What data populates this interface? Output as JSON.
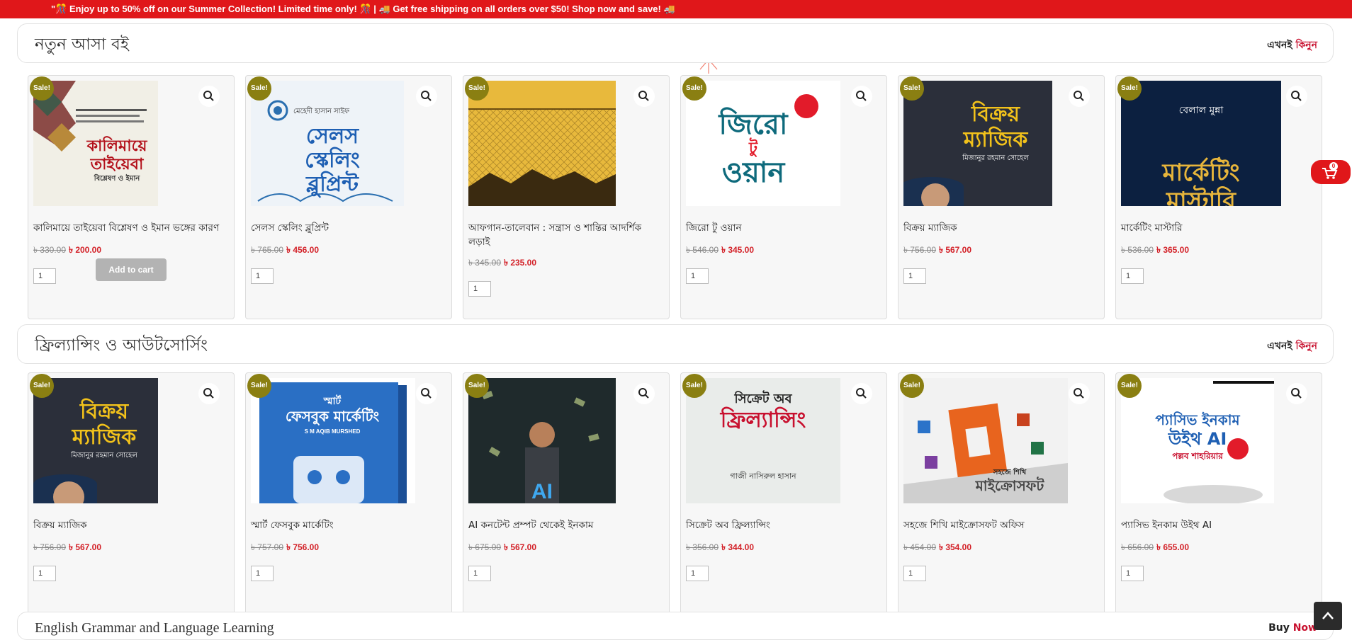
{
  "promo_bar": {
    "text": "\"🎊 Enjoy up to 50% off on our Summer Collection! Limited time only! 🎊 | 🚚 Get free shipping on all orders over $50! Shop now and save! 🚚"
  },
  "sections": [
    {
      "title": "নতুন আসা বই",
      "buy_now_word1": "এখনই",
      "buy_now_word2": "কিনুন",
      "products": [
        {
          "title": "কালিমায়ে তাইয়েবা বিশ্লেষণ ও ইমান ভঙ্গের কারণ",
          "old_price": "৳ 330.00",
          "price": "৳ 200.00",
          "qty": "1",
          "sale": "Sale!",
          "add_to_cart": "Add to cart",
          "cover_text": [
            "কালিমায়ে",
            "তাইয়েবা",
            "বিশ্লেষণ ও ইমান"
          ]
        },
        {
          "title": "সেলস স্কেলিং ব্লুপ্রিন্ট",
          "old_price": "৳ 765.00",
          "price": "৳ 456.00",
          "qty": "1",
          "sale": "Sale!",
          "cover_text": [
            "মেহেদী হাসান সাইফ",
            "সেলস",
            "স্কেলিং",
            "ব্লুপ্রিন্ট"
          ]
        },
        {
          "title": "আফগান-তালেবান : সন্ত্রাস ও শান্তির আদর্শিক লড়াই",
          "old_price": "৳ 345.00",
          "price": "৳ 235.00",
          "qty": "1",
          "sale": "Sale!"
        },
        {
          "title": "জিরো টু ওয়ান",
          "old_price": "৳ 546.00",
          "price": "৳ 345.00",
          "qty": "1",
          "sale": "Sale!",
          "cover_text": [
            "জিরো",
            "টু",
            "ওয়ান"
          ]
        },
        {
          "title": "বিক্রয় ম্যাজিক",
          "old_price": "৳ 756.00",
          "price": "৳ 567.00",
          "qty": "1",
          "sale": "Sale!",
          "cover_text": [
            "বিক্রয়",
            "ম্যাজিক",
            "মিজানুর রহমান সোহেল"
          ]
        },
        {
          "title": "মার্কেটিং মাস্টারি",
          "old_price": "৳ 536.00",
          "price": "৳ 365.00",
          "qty": "1",
          "sale": "Sale!",
          "cover_text": [
            "বেলাল মুন্না",
            "মার্কেটিং",
            "মাস্টারি"
          ]
        }
      ]
    },
    {
      "title": "ফ্রিল্যান্সিং ও আউটসোর্সিং",
      "buy_now_word1": "এখনই",
      "buy_now_word2": "কিনুন",
      "products": [
        {
          "title": "বিক্রয় ম্যাজিক",
          "old_price": "৳ 756.00",
          "price": "৳ 567.00",
          "qty": "1",
          "sale": "Sale!",
          "cover_text": [
            "বিক্রয়",
            "ম্যাজিক",
            "মিজানুর রহমান সোহেল"
          ]
        },
        {
          "title": "স্মার্ট ফেসবুক মার্কেটিং",
          "old_price": "৳ 757.00",
          "price": "৳ 756.00",
          "qty": "1",
          "sale": "Sale!",
          "cover_text": [
            "স্মার্ট",
            "ফেসবুক মার্কেটিং",
            "S M AQIB MURSHED"
          ]
        },
        {
          "title": "AI কনটেন্ট প্রম্পট থেকেই ইনকাম",
          "old_price": "৳ 675.00",
          "price": "৳ 567.00",
          "qty": "1",
          "sale": "Sale!",
          "cover_text": [
            "AI"
          ]
        },
        {
          "title": "সিক্রেট অব ফ্রিল্যান্সিং",
          "old_price": "৳ 356.00",
          "price": "৳ 344.00",
          "qty": "1",
          "sale": "Sale!",
          "cover_text": [
            "সিক্রেট অব",
            "ফ্রিল্যান্সিং",
            "গাজী নাসিরুল হাসান"
          ]
        },
        {
          "title": "সহজে শিখি মাইক্রোসফট অফিস",
          "old_price": "৳ 454.00",
          "price": "৳ 354.00",
          "qty": "1",
          "sale": "Sale!",
          "cover_text": [
            "সহজে শিখি",
            "মাইক্রোসফট"
          ]
        },
        {
          "title": "প্যাসিভ ইনকাম উইথ AI",
          "old_price": "৳ 656.00",
          "price": "৳ 655.00",
          "qty": "1",
          "sale": "Sale!",
          "cover_text": [
            "প্যাসিভ ইনকাম",
            "উইথ AI",
            "পল্লব শাহরিয়ার"
          ]
        }
      ]
    },
    {
      "title": "English Grammar and Language Learning",
      "buy_now_word1": "Buy",
      "buy_now_word2": "Now"
    }
  ],
  "cart": {
    "count": "0"
  },
  "colors": {
    "brand_red": "#e0171a",
    "price_red": "#d32027",
    "sale_badge": "#8a7f12"
  },
  "icons": [
    "search-icon",
    "cart-icon",
    "chevron-up-icon"
  ]
}
